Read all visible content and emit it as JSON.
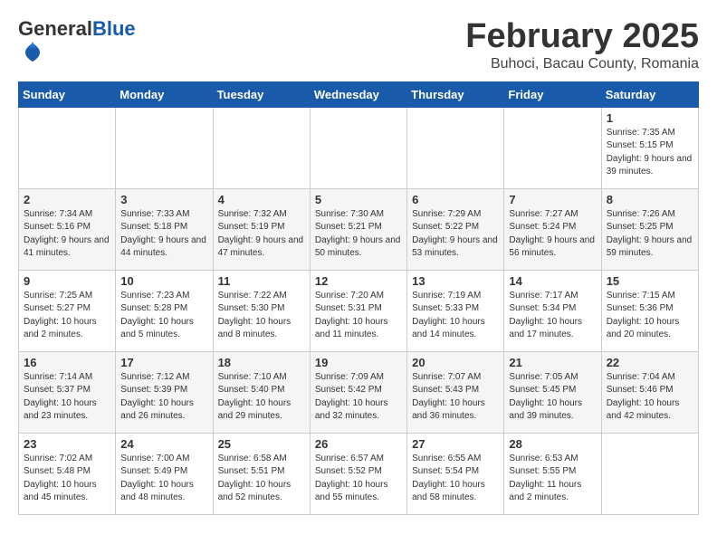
{
  "header": {
    "logo_general": "General",
    "logo_blue": "Blue",
    "month_title": "February 2025",
    "location": "Buhoci, Bacau County, Romania"
  },
  "days_of_week": [
    "Sunday",
    "Monday",
    "Tuesday",
    "Wednesday",
    "Thursday",
    "Friday",
    "Saturday"
  ],
  "weeks": [
    [
      {
        "day": "",
        "info": ""
      },
      {
        "day": "",
        "info": ""
      },
      {
        "day": "",
        "info": ""
      },
      {
        "day": "",
        "info": ""
      },
      {
        "day": "",
        "info": ""
      },
      {
        "day": "",
        "info": ""
      },
      {
        "day": "1",
        "info": "Sunrise: 7:35 AM\nSunset: 5:15 PM\nDaylight: 9 hours and 39 minutes."
      }
    ],
    [
      {
        "day": "2",
        "info": "Sunrise: 7:34 AM\nSunset: 5:16 PM\nDaylight: 9 hours and 41 minutes."
      },
      {
        "day": "3",
        "info": "Sunrise: 7:33 AM\nSunset: 5:18 PM\nDaylight: 9 hours and 44 minutes."
      },
      {
        "day": "4",
        "info": "Sunrise: 7:32 AM\nSunset: 5:19 PM\nDaylight: 9 hours and 47 minutes."
      },
      {
        "day": "5",
        "info": "Sunrise: 7:30 AM\nSunset: 5:21 PM\nDaylight: 9 hours and 50 minutes."
      },
      {
        "day": "6",
        "info": "Sunrise: 7:29 AM\nSunset: 5:22 PM\nDaylight: 9 hours and 53 minutes."
      },
      {
        "day": "7",
        "info": "Sunrise: 7:27 AM\nSunset: 5:24 PM\nDaylight: 9 hours and 56 minutes."
      },
      {
        "day": "8",
        "info": "Sunrise: 7:26 AM\nSunset: 5:25 PM\nDaylight: 9 hours and 59 minutes."
      }
    ],
    [
      {
        "day": "9",
        "info": "Sunrise: 7:25 AM\nSunset: 5:27 PM\nDaylight: 10 hours and 2 minutes."
      },
      {
        "day": "10",
        "info": "Sunrise: 7:23 AM\nSunset: 5:28 PM\nDaylight: 10 hours and 5 minutes."
      },
      {
        "day": "11",
        "info": "Sunrise: 7:22 AM\nSunset: 5:30 PM\nDaylight: 10 hours and 8 minutes."
      },
      {
        "day": "12",
        "info": "Sunrise: 7:20 AM\nSunset: 5:31 PM\nDaylight: 10 hours and 11 minutes."
      },
      {
        "day": "13",
        "info": "Sunrise: 7:19 AM\nSunset: 5:33 PM\nDaylight: 10 hours and 14 minutes."
      },
      {
        "day": "14",
        "info": "Sunrise: 7:17 AM\nSunset: 5:34 PM\nDaylight: 10 hours and 17 minutes."
      },
      {
        "day": "15",
        "info": "Sunrise: 7:15 AM\nSunset: 5:36 PM\nDaylight: 10 hours and 20 minutes."
      }
    ],
    [
      {
        "day": "16",
        "info": "Sunrise: 7:14 AM\nSunset: 5:37 PM\nDaylight: 10 hours and 23 minutes."
      },
      {
        "day": "17",
        "info": "Sunrise: 7:12 AM\nSunset: 5:39 PM\nDaylight: 10 hours and 26 minutes."
      },
      {
        "day": "18",
        "info": "Sunrise: 7:10 AM\nSunset: 5:40 PM\nDaylight: 10 hours and 29 minutes."
      },
      {
        "day": "19",
        "info": "Sunrise: 7:09 AM\nSunset: 5:42 PM\nDaylight: 10 hours and 32 minutes."
      },
      {
        "day": "20",
        "info": "Sunrise: 7:07 AM\nSunset: 5:43 PM\nDaylight: 10 hours and 36 minutes."
      },
      {
        "day": "21",
        "info": "Sunrise: 7:05 AM\nSunset: 5:45 PM\nDaylight: 10 hours and 39 minutes."
      },
      {
        "day": "22",
        "info": "Sunrise: 7:04 AM\nSunset: 5:46 PM\nDaylight: 10 hours and 42 minutes."
      }
    ],
    [
      {
        "day": "23",
        "info": "Sunrise: 7:02 AM\nSunset: 5:48 PM\nDaylight: 10 hours and 45 minutes."
      },
      {
        "day": "24",
        "info": "Sunrise: 7:00 AM\nSunset: 5:49 PM\nDaylight: 10 hours and 48 minutes."
      },
      {
        "day": "25",
        "info": "Sunrise: 6:58 AM\nSunset: 5:51 PM\nDaylight: 10 hours and 52 minutes."
      },
      {
        "day": "26",
        "info": "Sunrise: 6:57 AM\nSunset: 5:52 PM\nDaylight: 10 hours and 55 minutes."
      },
      {
        "day": "27",
        "info": "Sunrise: 6:55 AM\nSunset: 5:54 PM\nDaylight: 10 hours and 58 minutes."
      },
      {
        "day": "28",
        "info": "Sunrise: 6:53 AM\nSunset: 5:55 PM\nDaylight: 11 hours and 2 minutes."
      },
      {
        "day": "",
        "info": ""
      }
    ]
  ]
}
